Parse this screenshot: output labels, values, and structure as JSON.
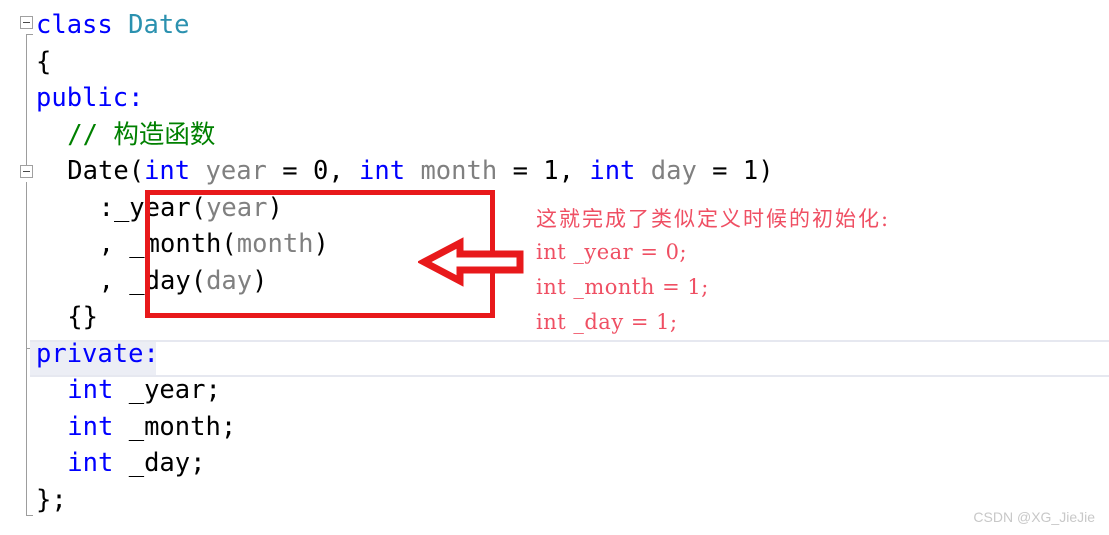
{
  "editor": {
    "language": "cpp",
    "background_color": "#ffffff",
    "colors": {
      "keyword": "#0000ff",
      "type": "#2b91af",
      "parameter": "#808080",
      "comment": "#008000",
      "plain": "#000000",
      "highlight_row": "#eceef5",
      "gutter_line": "#9d9d9d"
    },
    "gutter": {
      "collapse_markers": [
        {
          "name": "collapse-class-date",
          "state": "expanded",
          "glyph": "minus-square"
        },
        {
          "name": "collapse-constructor",
          "state": "expanded",
          "glyph": "minus-square"
        }
      ]
    },
    "lines": [
      {
        "n": 1,
        "indent": 0,
        "tokens": [
          {
            "t": "class",
            "c": "kw"
          },
          {
            "t": " ",
            "c": "punc"
          },
          {
            "t": "Date",
            "c": "type"
          }
        ]
      },
      {
        "n": 2,
        "indent": 0,
        "tokens": [
          {
            "t": "{",
            "c": "punc"
          }
        ]
      },
      {
        "n": 3,
        "indent": 0,
        "tokens": [
          {
            "t": "public:",
            "c": "kw"
          }
        ]
      },
      {
        "n": 4,
        "indent": 1,
        "tokens": [
          {
            "t": "// 构造函数",
            "c": "comment"
          }
        ]
      },
      {
        "n": 5,
        "indent": 1,
        "tokens": [
          {
            "t": "Date(",
            "c": "punc"
          },
          {
            "t": "int",
            "c": "kw"
          },
          {
            "t": " ",
            "c": "punc"
          },
          {
            "t": "year",
            "c": "param"
          },
          {
            "t": " = 0, ",
            "c": "punc"
          },
          {
            "t": "int",
            "c": "kw"
          },
          {
            "t": " ",
            "c": "punc"
          },
          {
            "t": "month",
            "c": "param"
          },
          {
            "t": " = 1, ",
            "c": "punc"
          },
          {
            "t": "int",
            "c": "kw"
          },
          {
            "t": " ",
            "c": "punc"
          },
          {
            "t": "day",
            "c": "param"
          },
          {
            "t": " = 1)",
            "c": "punc"
          }
        ]
      },
      {
        "n": 6,
        "indent": 2,
        "tokens": [
          {
            "t": ":_year(",
            "c": "punc"
          },
          {
            "t": "year",
            "c": "param"
          },
          {
            "t": ")",
            "c": "punc"
          }
        ]
      },
      {
        "n": 7,
        "indent": 2,
        "tokens": [
          {
            "t": ", _month(",
            "c": "punc"
          },
          {
            "t": "month",
            "c": "param"
          },
          {
            "t": ")",
            "c": "punc"
          }
        ]
      },
      {
        "n": 8,
        "indent": 2,
        "tokens": [
          {
            "t": ", _day(",
            "c": "punc"
          },
          {
            "t": "day",
            "c": "param"
          },
          {
            "t": ")",
            "c": "punc"
          }
        ]
      },
      {
        "n": 9,
        "indent": 1,
        "tokens": [
          {
            "t": "{}",
            "c": "punc"
          }
        ]
      },
      {
        "n": 10,
        "indent": 0,
        "highlighted": true,
        "tokens": [
          {
            "t": "private:",
            "c": "kw"
          }
        ]
      },
      {
        "n": 11,
        "indent": 1,
        "tokens": [
          {
            "t": "int",
            "c": "kw"
          },
          {
            "t": " _year;",
            "c": "punc"
          }
        ]
      },
      {
        "n": 12,
        "indent": 1,
        "tokens": [
          {
            "t": "int",
            "c": "kw"
          },
          {
            "t": " _month;",
            "c": "punc"
          }
        ]
      },
      {
        "n": 13,
        "indent": 1,
        "tokens": [
          {
            "t": "int",
            "c": "kw"
          },
          {
            "t": " _day;",
            "c": "punc"
          }
        ]
      },
      {
        "n": 14,
        "indent": 0,
        "tokens": [
          {
            "t": "};",
            "c": "punc"
          }
        ]
      }
    ]
  },
  "annotation": {
    "box_color": "#e8191b",
    "arrow": {
      "name": "left-pointing-arrow",
      "direction": "left",
      "stroke_color": "#e8191b",
      "fill_color": "#ffffff"
    },
    "text_color": "#ef4f63",
    "lines": [
      "这就完成了类似定义时候的初始化:",
      "int _year = 0;",
      "int _month = 1;",
      "int _day = 1;"
    ]
  },
  "watermark": {
    "text": "CSDN @XG_JieJie"
  }
}
